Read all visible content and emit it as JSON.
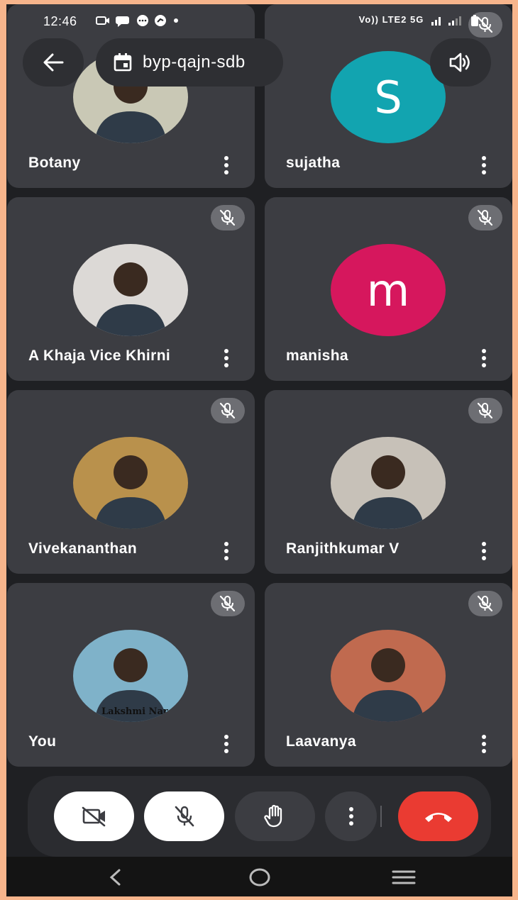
{
  "status_bar": {
    "time": "12:46",
    "network": "Vo)) LTE2 5G",
    "notification_icons": [
      "video-icon",
      "chat-icon",
      "message-icon",
      "gauge-icon",
      "dot-icon"
    ]
  },
  "header": {
    "meeting_code": "byp-qajn-sdb"
  },
  "participants": [
    {
      "name": "Botany",
      "avatar": "photo",
      "avatar_color": "#c9c8b5",
      "muted": false
    },
    {
      "name": "sujatha",
      "avatar": "letter",
      "initial": "S",
      "avatar_color": "#12a4b0",
      "muted": true
    },
    {
      "name": "A Khaja Vice Khirni",
      "avatar": "photo",
      "avatar_color": "#dcd9d6",
      "muted": true
    },
    {
      "name": "manisha",
      "avatar": "letter",
      "initial": "m",
      "avatar_color": "#d6175d",
      "muted": true
    },
    {
      "name": "Vivekananthan",
      "avatar": "photo",
      "avatar_color": "#b9914c",
      "muted": true
    },
    {
      "name": "Ranjithkumar V",
      "avatar": "photo",
      "avatar_color": "#c7c1b8",
      "muted": true
    },
    {
      "name": "You",
      "avatar": "photo",
      "avatar_color": "#7fb2c9",
      "muted": true,
      "photo_caption": "Lakshmi Nar"
    },
    {
      "name": "Laavanya",
      "avatar": "photo",
      "avatar_color": "#c06a4f",
      "muted": true
    }
  ],
  "controls": {
    "camera": "camera-off-icon",
    "mic": "mic-off-icon",
    "hand": "raise-hand-icon",
    "more": "more-vert-icon",
    "end": "end-call-icon",
    "end_color": "#ea3b32"
  },
  "navigation": [
    "back-nav",
    "home-nav",
    "recents-nav"
  ]
}
